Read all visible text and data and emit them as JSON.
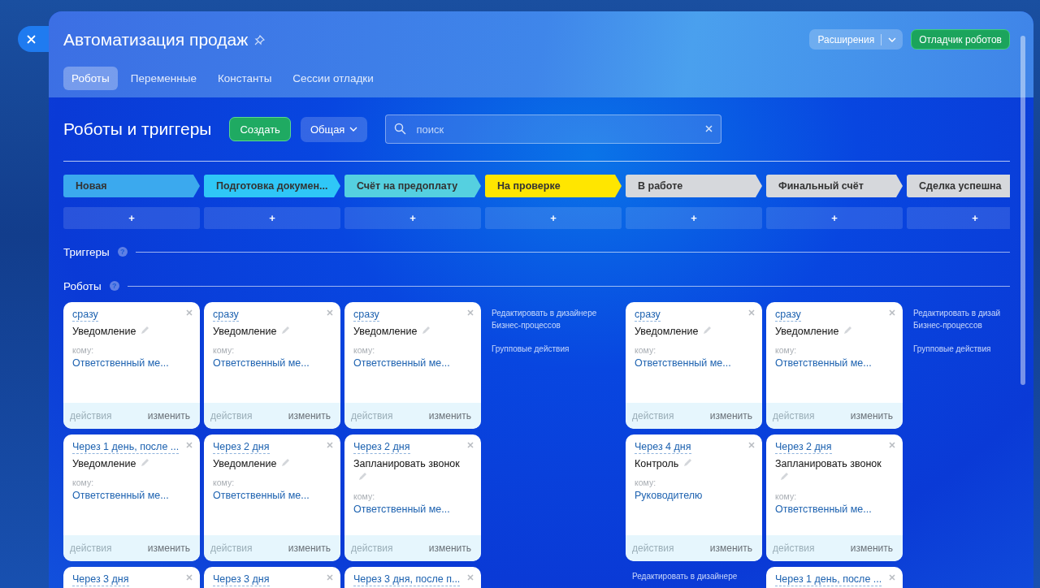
{
  "header": {
    "title": "Автоматизация продаж",
    "extensions_button": "Расширения",
    "debugger_button": "Отладчик роботов"
  },
  "tabs": [
    {
      "label": "Роботы",
      "selected": true
    },
    {
      "label": "Переменные",
      "selected": false
    },
    {
      "label": "Константы",
      "selected": false
    },
    {
      "label": "Сессии отладки",
      "selected": false
    }
  ],
  "toolbar": {
    "title": "Роботы и триггеры",
    "create_button": "Создать",
    "filter_button": "Общая",
    "search": {
      "placeholder": "поиск"
    }
  },
  "stages": [
    {
      "name": "Новая",
      "color": "#3ba9ee",
      "add": "+"
    },
    {
      "name": "Подготовка докумен...",
      "color": "#2fc7f7",
      "add": "+"
    },
    {
      "name": "Счёт на предоплату",
      "color": "#55d0e0",
      "add": "+"
    },
    {
      "name": "На проверке",
      "color": "#ffe600",
      "add": "+"
    },
    {
      "name": "В работе",
      "color": "#d6d8dc",
      "add": "+"
    },
    {
      "name": "Финальный счёт",
      "color": "#d6d8dc",
      "add": "+"
    },
    {
      "name": "Сделка успешна",
      "color": "#d6d8dc",
      "add": "+"
    }
  ],
  "triggers": {
    "label": "Триггеры",
    "help": "?"
  },
  "robots": {
    "label": "Роботы",
    "help": "?"
  },
  "robot_columns": [
    {
      "cards": [
        {
          "delay": "сразу",
          "title": "Уведомление",
          "recipient_label": "кому:",
          "recipient": "Ответственный ме...",
          "actions": "действия",
          "actions_disabled": true,
          "edit": "изменить"
        },
        {
          "delay": "Через 1 день, после ...",
          "title": "Уведомление",
          "recipient_label": "кому:",
          "recipient": "Ответственный ме...",
          "actions": "действия",
          "actions_disabled": true,
          "edit": "изменить"
        },
        {
          "delay": "Через 3 дня"
        }
      ]
    },
    {
      "cards": [
        {
          "delay": "сразу",
          "title": "Уведомление",
          "recipient_label": "кому:",
          "recipient": "Ответственный ме...",
          "actions": "действия",
          "actions_disabled": true,
          "edit": "изменить"
        },
        {
          "delay": "Через 2 дня",
          "title": "Уведомление",
          "recipient_label": "кому:",
          "recipient": "Ответственный ме...",
          "actions": "действия",
          "actions_disabled": true,
          "edit": "изменить"
        },
        {
          "delay": "Через 3 дня"
        }
      ]
    },
    {
      "cards": [
        {
          "delay": "сразу",
          "title": "Уведомление",
          "recipient_label": "кому:",
          "recipient": "Ответственный ме...",
          "actions": "действия",
          "actions_disabled": true,
          "edit": "изменить"
        },
        {
          "delay": "Через 2 дня",
          "title": "Запланировать звонок",
          "recipient_label": "кому:",
          "recipient": "Ответственный ме...",
          "actions": "действия",
          "actions_disabled": true,
          "edit": "изменить"
        },
        {
          "delay": "Через 3 дня, после п..."
        }
      ]
    },
    {
      "links": [
        "Редактировать в дизайнере Бизнес-процессов",
        "Групповые действия"
      ]
    },
    {
      "cards": [
        {
          "delay": "сразу",
          "title": "Уведомление",
          "recipient_label": "кому:",
          "recipient": "Ответственный ме...",
          "actions": "действия",
          "actions_disabled": true,
          "edit": "изменить"
        },
        {
          "delay": "Через 4 дня",
          "title": "Контроль",
          "recipient_label": "кому:",
          "recipient": "Руководителю",
          "actions": "действия",
          "actions_disabled": true,
          "edit": "изменить"
        }
      ],
      "links": [
        "Редактировать в дизайнере"
      ]
    },
    {
      "cards": [
        {
          "delay": "сразу",
          "title": "Уведомление",
          "recipient_label": "кому:",
          "recipient": "Ответственный ме...",
          "actions": "действия",
          "actions_disabled": true,
          "edit": "изменить"
        },
        {
          "delay": "Через 2 дня",
          "title": "Запланировать звонок",
          "recipient_label": "кому:",
          "recipient": "Ответственный ме...",
          "actions": "действия",
          "actions_disabled": true,
          "edit": "изменить"
        },
        {
          "delay": "Через 1 день, после ..."
        }
      ]
    },
    {
      "links": [
        "Редактировать в дизай Бизнес-процессов",
        "Групповые действия"
      ]
    }
  ]
}
